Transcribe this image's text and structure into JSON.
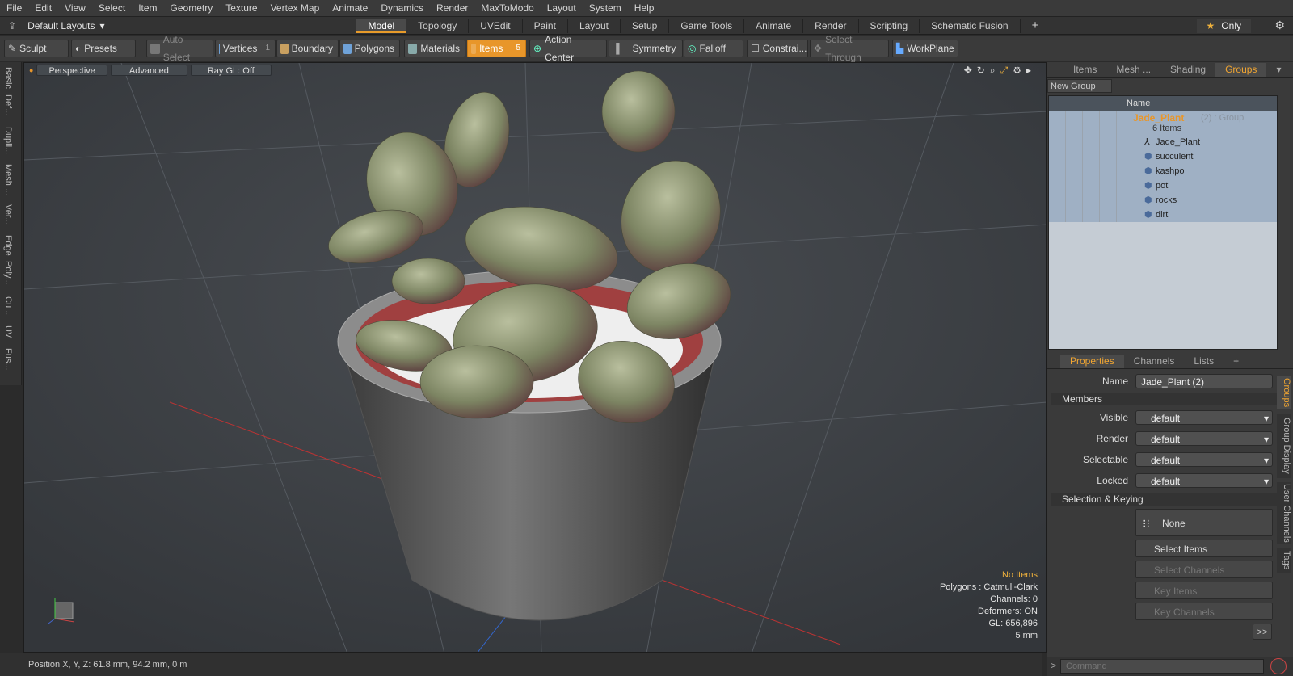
{
  "menu": [
    "File",
    "Edit",
    "View",
    "Select",
    "Item",
    "Geometry",
    "Texture",
    "Vertex Map",
    "Animate",
    "Dynamics",
    "Render",
    "MaxToModo",
    "Layout",
    "System",
    "Help"
  ],
  "layout": {
    "dropdown": "Default Layouts",
    "tabs": [
      "Model",
      "Topology",
      "UVEdit",
      "Paint",
      "Layout",
      "Setup",
      "Game Tools",
      "Animate",
      "Render",
      "Scripting",
      "Schematic Fusion"
    ],
    "active": "Model",
    "only": "Only"
  },
  "toolbar": {
    "sculpt": "Sculpt",
    "presets": "Presets",
    "auto_select": "Auto Select",
    "vertices": "Vertices",
    "vertices_count": "1",
    "boundary": "Boundary",
    "polygons": "Polygons",
    "materials": "Materials",
    "items": "Items",
    "items_count": "5",
    "action_center": "Action Center",
    "symmetry": "Symmetry",
    "falloff": "Falloff",
    "constrain": "Constrai...",
    "select_through": "Select Through",
    "workplane": "WorkPlane"
  },
  "lefttabs": [
    "Basic",
    "Def...",
    "Dupli...",
    "Mesh ...",
    "Ver...",
    "Edge",
    "Poly...",
    "Cu...",
    "UV",
    "Fus..."
  ],
  "viewport": {
    "perspective": "Perspective",
    "advanced": "Advanced",
    "raygl": "Ray GL: Off",
    "no_items": "No Items",
    "polygons": "Polygons : Catmull-Clark",
    "channels": "Channels: 0",
    "deformers": "Deformers: ON",
    "gl": "GL: 656,896",
    "scale": "5 mm"
  },
  "status": {
    "position": "Position X, Y, Z:  61.8 mm, 94.2 mm, 0 m"
  },
  "outliner": {
    "tabs": [
      "Items",
      "Mesh ...",
      "Shading",
      "Groups"
    ],
    "active": "Groups",
    "new_group": "New Group",
    "name_col": "Name",
    "group_name": "Jade_Plant",
    "group_suffix": "(2) : Group",
    "group_count": "6 Items",
    "children": [
      "Jade_Plant",
      "succulent",
      "kashpo",
      "pot",
      "rocks",
      "dirt"
    ]
  },
  "properties": {
    "tabs": [
      "Properties",
      "Channels",
      "Lists"
    ],
    "name_label": "Name",
    "name_value": "Jade_Plant (2)",
    "members": "Members",
    "visible": "Visible",
    "render": "Render",
    "selectable": "Selectable",
    "locked": "Locked",
    "default": "default",
    "selection_keying": "Selection & Keying",
    "none": "None",
    "select_items": "Select Items",
    "select_channels": "Select Channels",
    "key_items": "Key Items",
    "key_channels": "Key Channels",
    "more": ">>"
  },
  "sidetabs": [
    "Groups",
    "Group Display",
    "User Channels",
    "Tags"
  ],
  "command": {
    "placeholder": "Command"
  },
  "colors": {
    "accent": "#e8962a",
    "selection": "#9fb0c4"
  }
}
